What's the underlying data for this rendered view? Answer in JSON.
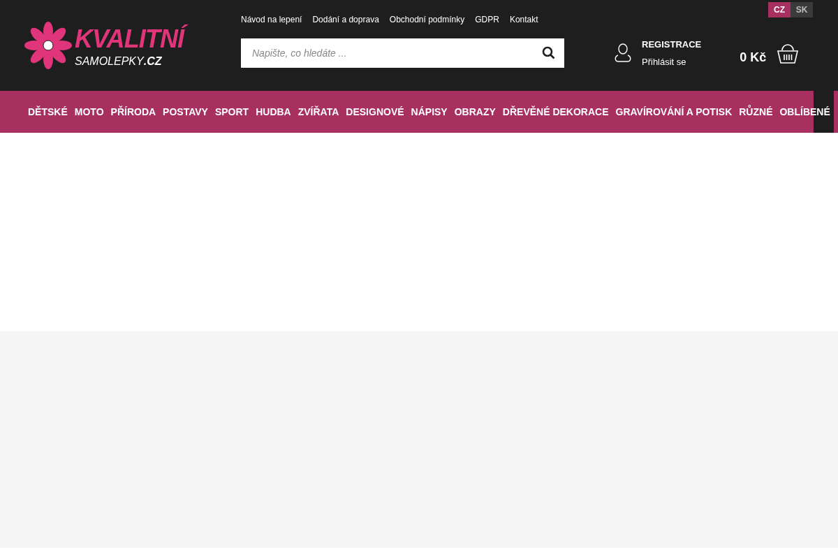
{
  "logo": {
    "title": "KVALITNÍ",
    "subtitle": "SAMOLEPKY",
    "domain": ".CZ"
  },
  "top_links": [
    "Návod na lepení",
    "Dodání a doprava",
    "Obchodní podmínky",
    "GDPR",
    "Kontakt"
  ],
  "languages": [
    {
      "label": "CZ",
      "selected": true
    },
    {
      "label": "SK",
      "selected": false
    }
  ],
  "search": {
    "placeholder": "Napište, co hledáte ..."
  },
  "account": {
    "register": "REGISTRACE",
    "login": "Přihlásit se"
  },
  "cart": {
    "total": "0 Kč"
  },
  "nav": [
    "DĚTSKÉ",
    "MOTO",
    "PŘÍRODA",
    "POSTAVY",
    "SPORT",
    "HUDBA",
    "ZVÍŘATA",
    "DESIGNOVÉ",
    "NÁPISY",
    "OBRAZY",
    "DŘEVĚNÉ DEKORACE",
    "GRAVÍROVÁNÍ A POTISK",
    "RŮZNÉ",
    "OBLÍBENÉ"
  ]
}
